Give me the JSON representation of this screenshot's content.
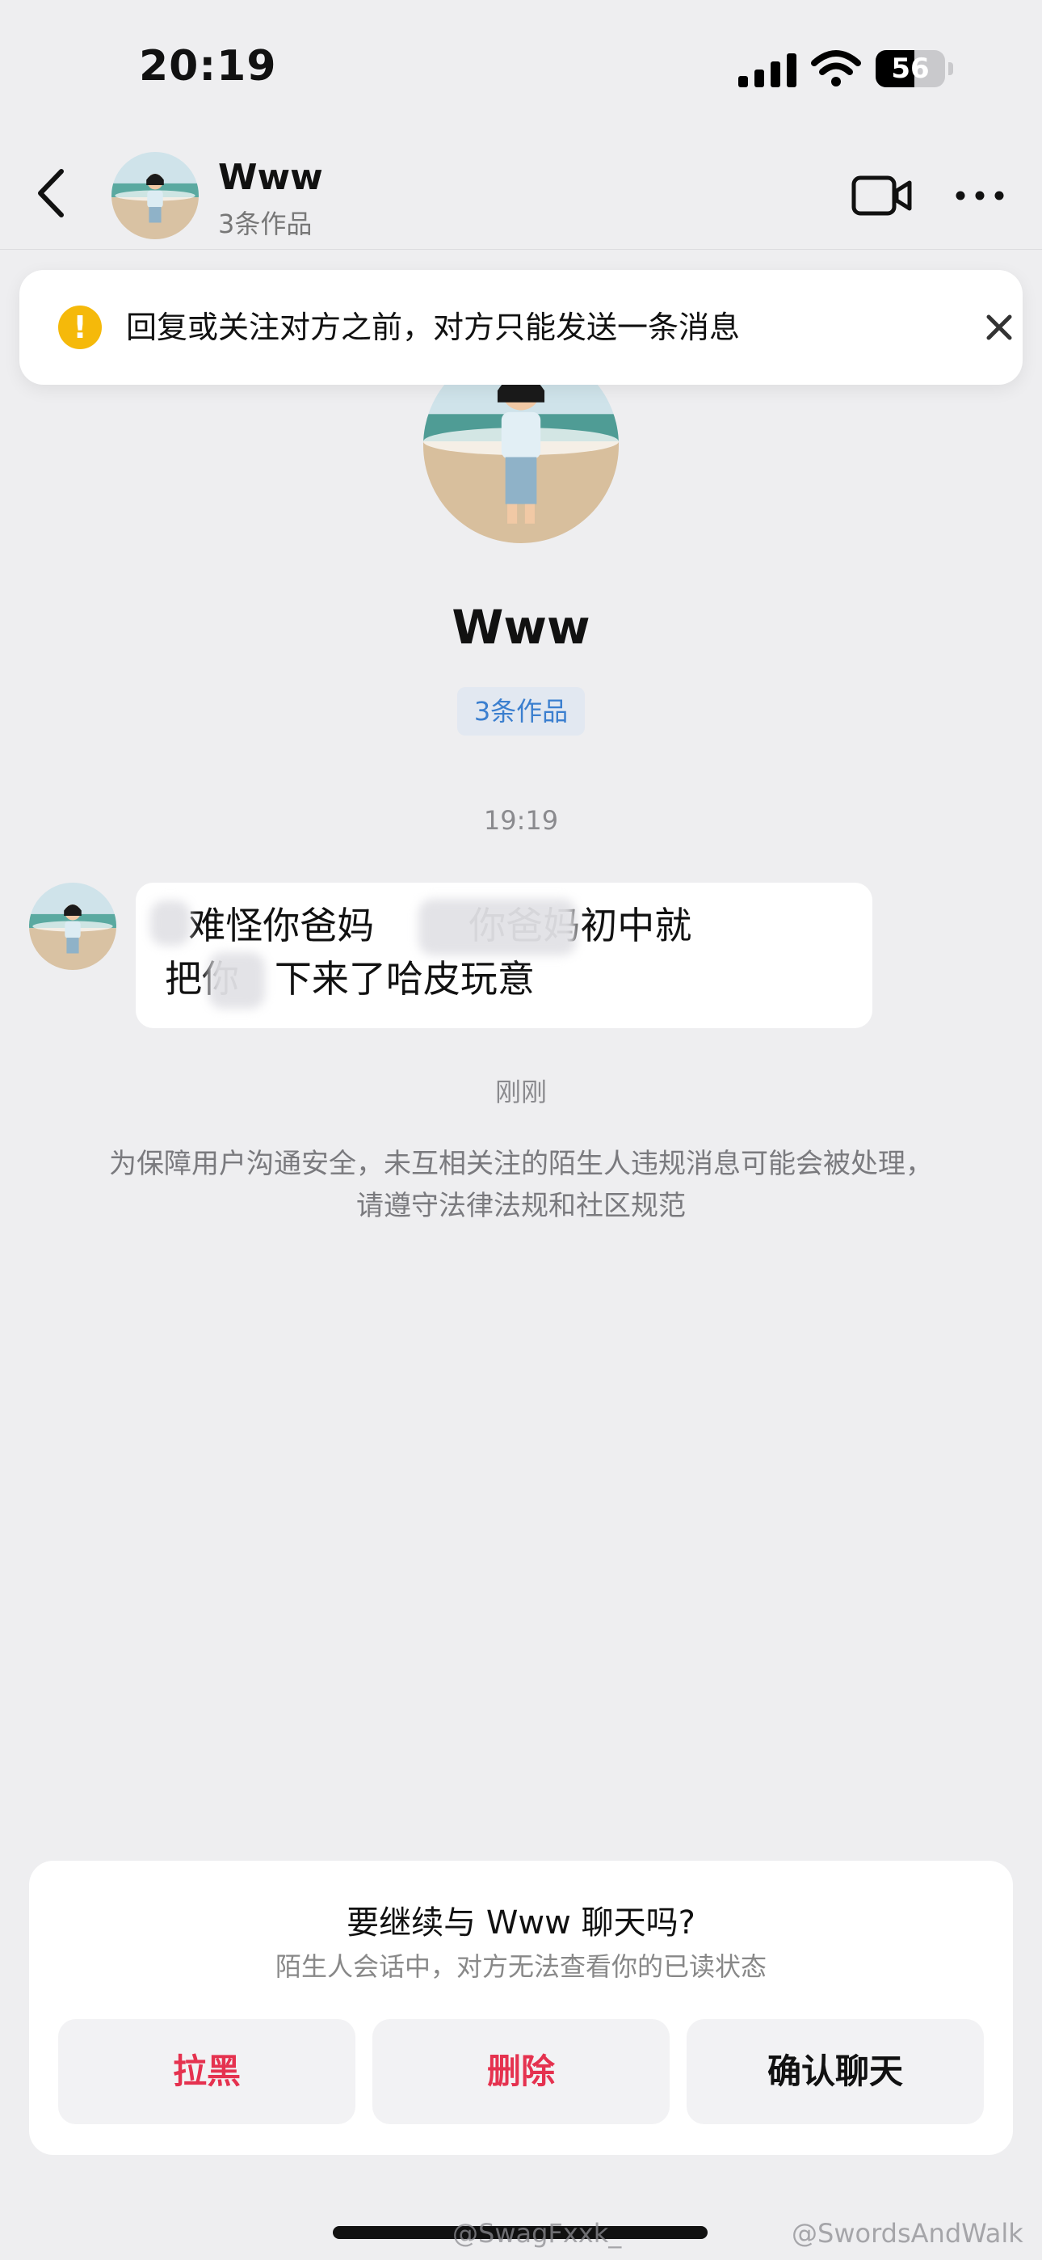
{
  "status_bar": {
    "time": "20:19",
    "battery": "56",
    "battery_level": 0.56
  },
  "header": {
    "name": "Www",
    "subtitle": "3条作品"
  },
  "notice": {
    "text": "回复或关注对方之前，对方只能发送一条消息"
  },
  "profile": {
    "name": "Www",
    "works": "3条作品"
  },
  "messages": {
    "timestamp": "19:19",
    "line1": "  难怪你爸妈        你爸妈初中就",
    "line2": "把你   下来了哈皮玩意",
    "after_time": "刚刚"
  },
  "safety_notice": "为保障用户沟通安全，未互相关注的陌生人违规消息可能会被处理，请遵守法律法规和社区规范",
  "prompt": {
    "title": "要继续与 Www 聊天吗?",
    "subtitle": "陌生人会话中，对方无法查看你的已读状态",
    "block": "拉黑",
    "delete": "删除",
    "confirm": "确认聊天"
  },
  "watermarks": {
    "left": "@SwagFxxk_",
    "right": "@SwordsAndWalk"
  },
  "colors": {
    "danger": "#e5324f",
    "link": "#3b7fcf",
    "warning": "#f5b90a"
  },
  "icons": [
    "back-icon",
    "video-icon",
    "more-icon",
    "warning-icon",
    "close-icon",
    "signal-icon",
    "wifi-icon",
    "battery-icon"
  ]
}
